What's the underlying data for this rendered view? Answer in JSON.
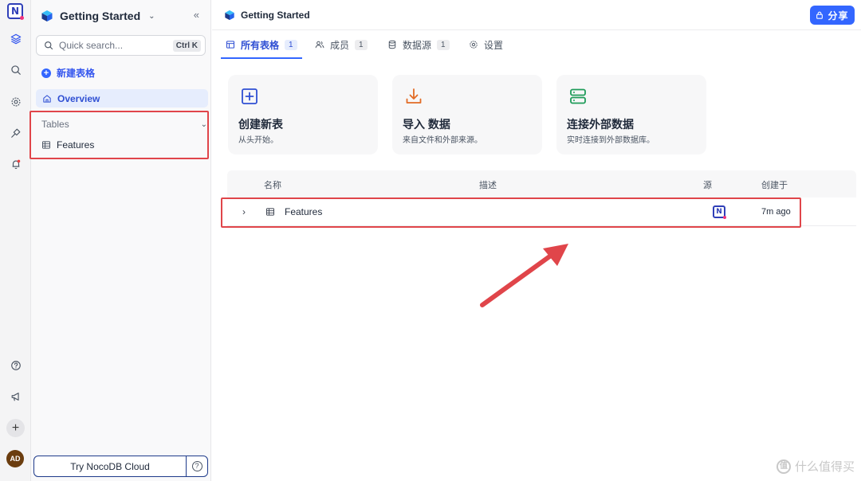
{
  "rail": {
    "logo_letter": "N",
    "avatar_initials": "AD",
    "icons": [
      "nocodb-logo-icon",
      "layers-icon",
      "search-icon",
      "settings-icon",
      "plug-icon",
      "bell-icon",
      "help-icon",
      "megaphone-icon",
      "plus-icon"
    ]
  },
  "sidebar": {
    "workspace_title": "Getting Started",
    "search_placeholder": "Quick search...",
    "search_shortcut": "Ctrl K",
    "new_table_label": "新建表格",
    "overview_label": "Overview",
    "tables_section_label": "Tables",
    "tables": [
      {
        "name": "Features"
      }
    ],
    "cloud_button_label": "Try NocoDB Cloud",
    "help_glyph": "?"
  },
  "topbar": {
    "breadcrumb_title": "Getting Started",
    "share_label": "分享"
  },
  "tabs": [
    {
      "label": "所有表格",
      "count": "1",
      "active": true
    },
    {
      "label": "成员",
      "count": "1",
      "active": false
    },
    {
      "label": "数据源",
      "count": "1",
      "active": false
    },
    {
      "label": "设置",
      "count": "",
      "active": false
    }
  ],
  "cards": [
    {
      "title": "创建新表",
      "desc": "从头开始。",
      "icon": "plus-square-icon"
    },
    {
      "title": "导入 数据",
      "desc": "来自文件和外部来源。",
      "icon": "download-icon"
    },
    {
      "title": "连接外部数据",
      "desc": "实时连接到外部数据库。",
      "icon": "server-icon"
    }
  ],
  "table": {
    "headers": {
      "name": "名称",
      "description": "描述",
      "source": "源",
      "created": "创建于"
    },
    "rows": [
      {
        "name": "Features",
        "description": "",
        "source_logo": "N",
        "created": "7m ago"
      }
    ]
  },
  "watermark": {
    "text": "什么值得买",
    "icon_glyph": "值"
  },
  "colors": {
    "accent": "#3366ff",
    "annotation_red": "#e0454a",
    "logo_blue": "#2f3fb8",
    "logo_pink": "#f0327d"
  }
}
